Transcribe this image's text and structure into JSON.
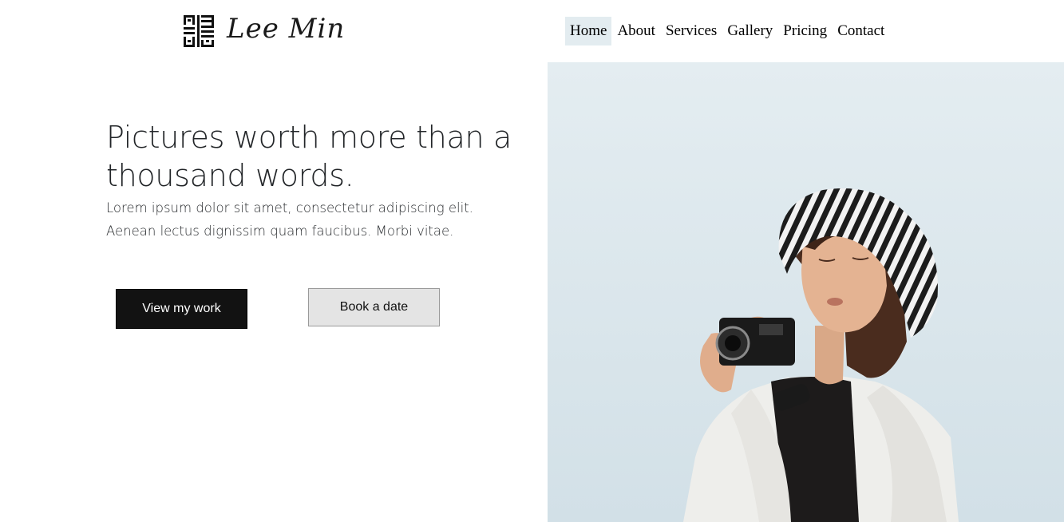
{
  "brand": {
    "name": "Lee Min",
    "logo_icon": "square-glyph-monogram"
  },
  "nav": {
    "items": [
      {
        "label": "Home",
        "active": true
      },
      {
        "label": "About",
        "active": false
      },
      {
        "label": "Services",
        "active": false
      },
      {
        "label": "Gallery",
        "active": false
      },
      {
        "label": "Pricing",
        "active": false
      },
      {
        "label": "Contact",
        "active": false
      }
    ]
  },
  "hero": {
    "title": "Pictures worth more than a thousand words.",
    "description": "Lorem ipsum dolor sit amet, consectetur adipiscing elit. Aenean lectus dignissim quam faucibus. Morbi vitae.",
    "primary_button": "View my work",
    "secondary_button": "Book a date"
  },
  "colors": {
    "primary_button_bg": "#121212",
    "secondary_button_bg": "#e4e4e4",
    "nav_active_bg": "#e3ecf0",
    "sky": "#dde8ed"
  }
}
